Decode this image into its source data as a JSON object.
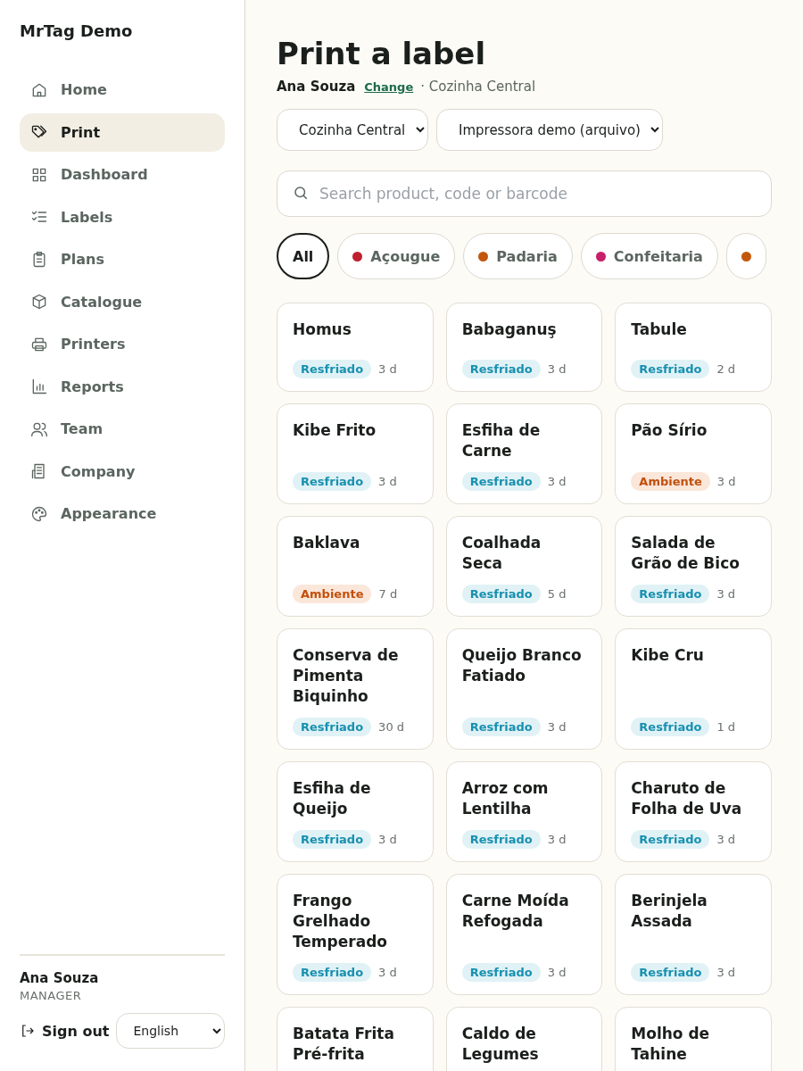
{
  "sidebar": {
    "brand": "MrTag Demo",
    "items": [
      {
        "label": "Home",
        "kind": "home",
        "selected": false
      },
      {
        "label": "Print",
        "kind": "tag",
        "selected": true
      },
      {
        "label": "Dashboard",
        "kind": "grid",
        "selected": false
      },
      {
        "label": "Labels",
        "kind": "checklist",
        "selected": false
      },
      {
        "label": "Plans",
        "kind": "clipboard",
        "selected": false
      },
      {
        "label": "Catalogue",
        "kind": "box",
        "selected": false
      },
      {
        "label": "Printers",
        "kind": "printer",
        "selected": false
      },
      {
        "label": "Reports",
        "kind": "chart",
        "selected": false
      },
      {
        "label": "Team",
        "kind": "users",
        "selected": false
      },
      {
        "label": "Company",
        "kind": "building",
        "selected": false
      },
      {
        "label": "Appearance",
        "kind": "palette",
        "selected": false
      }
    ],
    "user": {
      "name": "Ana Souza",
      "role": "MANAGER"
    },
    "sign_out": "Sign out",
    "language": "English"
  },
  "main": {
    "title": "Print a label",
    "operator": "Ana Souza",
    "change": "Change",
    "location": "· Cozinha Central",
    "selects": [
      "Cozinha Central",
      "Impressora demo (arquivo)"
    ],
    "search": {
      "placeholder": "Search product, code or barcode"
    },
    "categories": [
      {
        "label": "All",
        "selected": true
      },
      {
        "label": "Açougue",
        "color": "#c0202e",
        "selected": false
      },
      {
        "label": "Padaria",
        "color": "#c2570c",
        "selected": false
      },
      {
        "label": "Confeitaria",
        "color": "#c81e6a",
        "selected": false
      },
      {
        "color": "#c2570c",
        "selected": false
      }
    ],
    "products": [
      {
        "name": "Homus",
        "storage": "Resfriado",
        "kind": "chilled",
        "shelf_life": "3 d"
      },
      {
        "name": "Babaganuş",
        "storage": "Resfriado",
        "kind": "chilled",
        "shelf_life": "3 d"
      },
      {
        "name": "Tabule",
        "storage": "Resfriado",
        "kind": "chilled",
        "shelf_life": "2 d"
      },
      {
        "name": "Kibe Frito",
        "storage": "Resfriado",
        "kind": "chilled",
        "shelf_life": "3 d"
      },
      {
        "name": "Esfiha de Carne",
        "storage": "Resfriado",
        "kind": "chilled",
        "shelf_life": "3 d"
      },
      {
        "name": "Pão Sírio",
        "storage": "Ambiente",
        "kind": "ambient",
        "shelf_life": "3 d"
      },
      {
        "name": "Baklava",
        "storage": "Ambiente",
        "kind": "ambient",
        "shelf_life": "7 d"
      },
      {
        "name": "Coalhada Seca",
        "storage": "Resfriado",
        "kind": "chilled",
        "shelf_life": "5 d"
      },
      {
        "name": "Salada de Grão de Bico",
        "storage": "Resfriado",
        "kind": "chilled",
        "shelf_life": "3 d"
      },
      {
        "name": "Conserva de Pimenta Biquinho",
        "storage": "Resfriado",
        "kind": "chilled",
        "shelf_life": "30 d"
      },
      {
        "name": "Queijo Branco Fatiado",
        "storage": "Resfriado",
        "kind": "chilled",
        "shelf_life": "3 d"
      },
      {
        "name": "Kibe Cru",
        "storage": "Resfriado",
        "kind": "chilled",
        "shelf_life": "1 d"
      },
      {
        "name": "Esfiha de Queijo",
        "storage": "Resfriado",
        "kind": "chilled",
        "shelf_life": "3 d"
      },
      {
        "name": "Arroz com Lentilha",
        "storage": "Resfriado",
        "kind": "chilled",
        "shelf_life": "3 d"
      },
      {
        "name": "Charuto de Folha de Uva",
        "storage": "Resfriado",
        "kind": "chilled",
        "shelf_life": "3 d"
      },
      {
        "name": "Frango Grelhado Temperado",
        "storage": "Resfriado",
        "kind": "chilled",
        "shelf_life": "3 d"
      },
      {
        "name": "Carne Moída Refogada",
        "storage": "Resfriado",
        "kind": "chilled",
        "shelf_life": "3 d"
      },
      {
        "name": "Berinjela Assada",
        "storage": "Resfriado",
        "kind": "chilled",
        "shelf_life": "3 d"
      },
      {
        "name": "Batata Frita Pré-frita"
      },
      {
        "name": "Caldo de Legumes"
      },
      {
        "name": "Molho de Tahine"
      }
    ]
  }
}
